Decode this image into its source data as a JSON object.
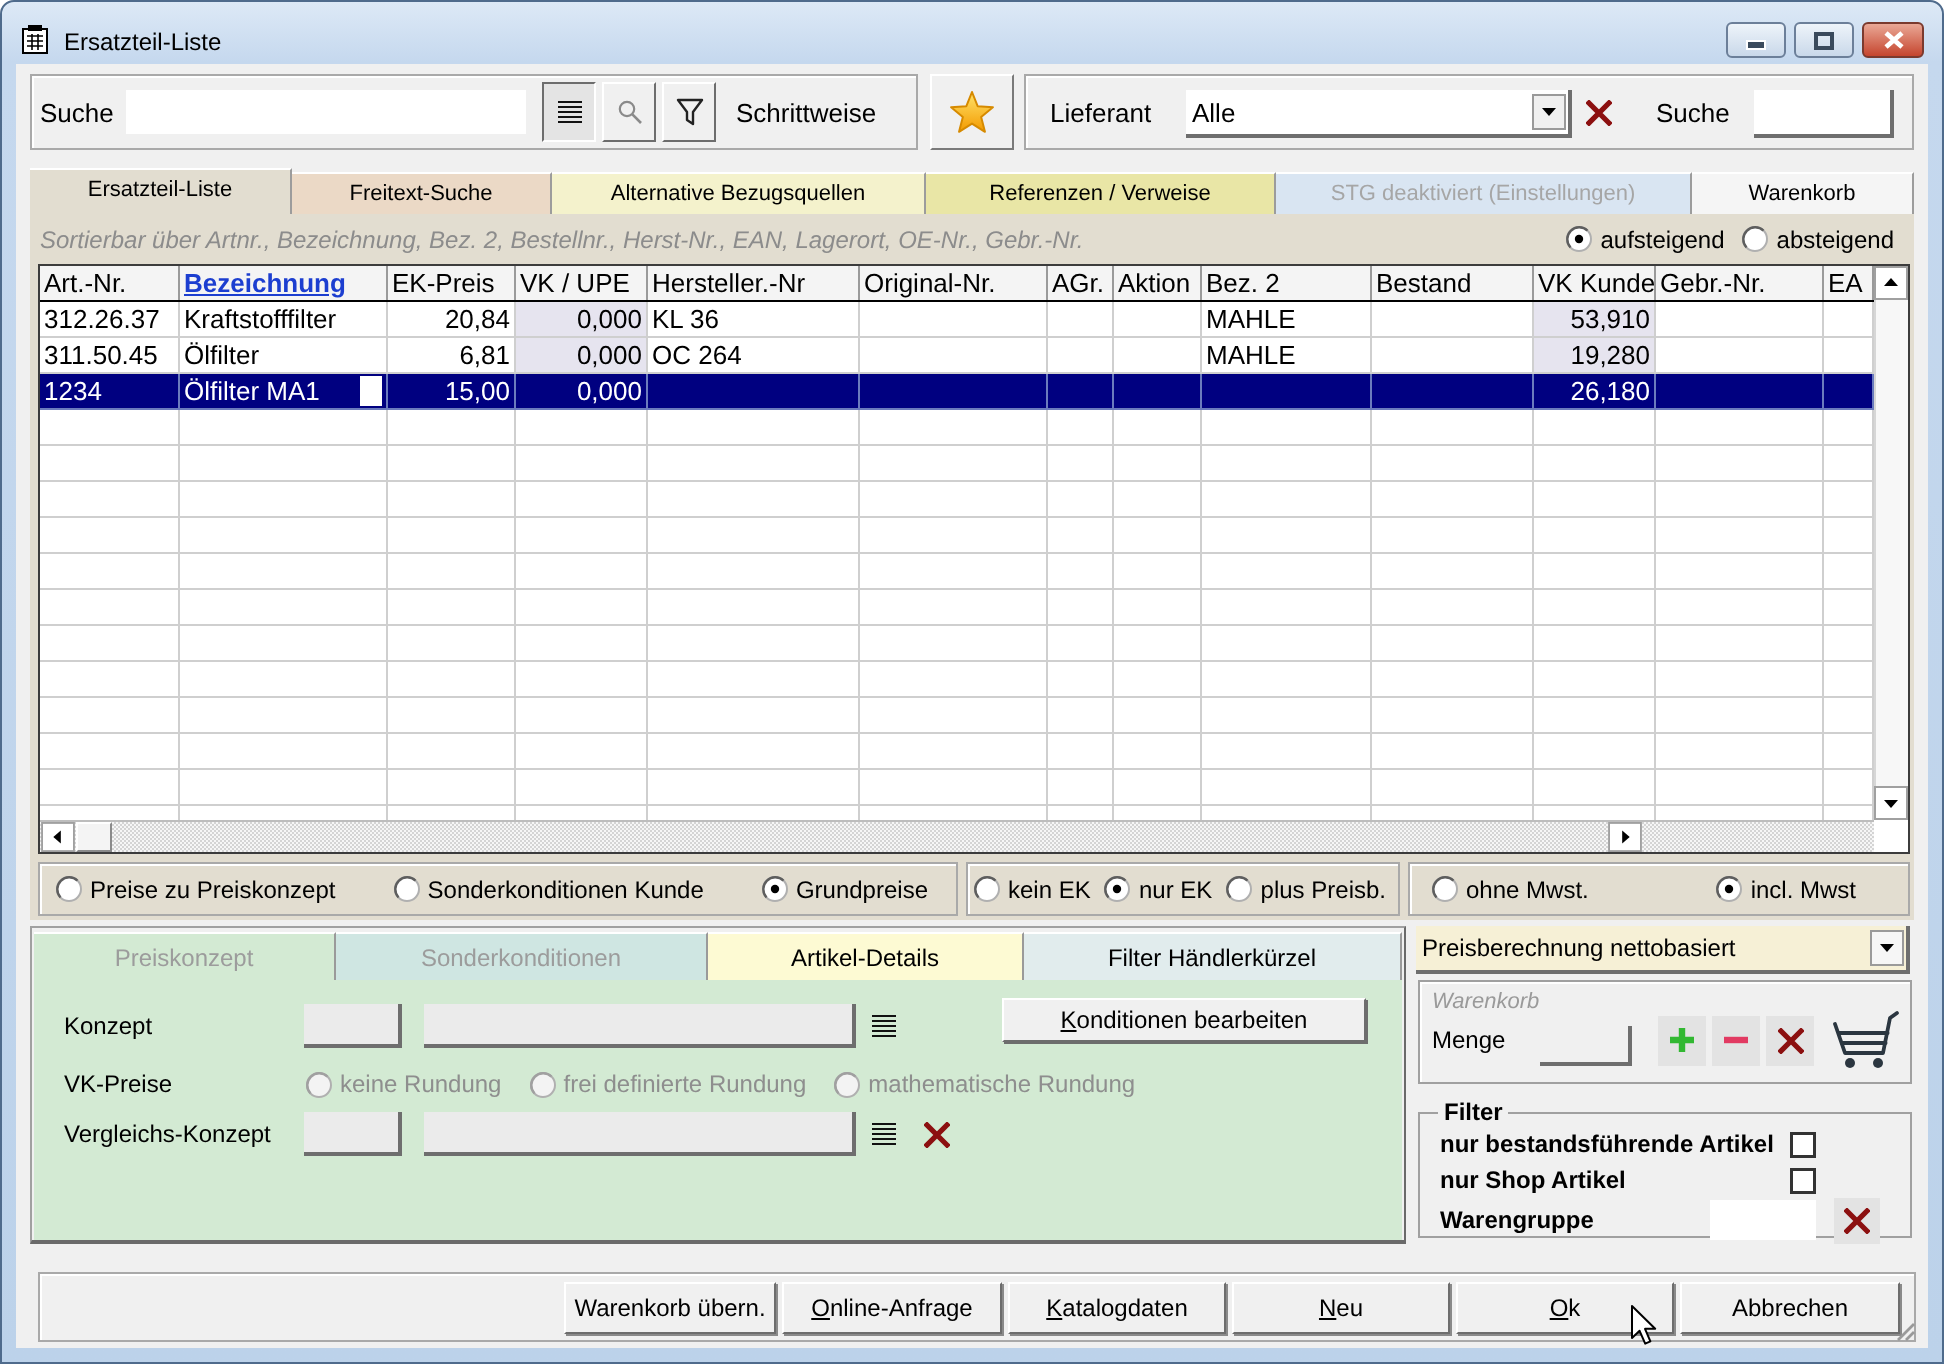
{
  "window": {
    "title": "Ersatzteil-Liste"
  },
  "search": {
    "label": "Suche",
    "view_buttons": [
      {
        "kind": "list",
        "selected": true
      },
      {
        "kind": "search",
        "selected": false
      },
      {
        "kind": "filter",
        "selected": false
      }
    ],
    "mode": "Schrittweise"
  },
  "supplier": {
    "label": "Lieferant",
    "value": "Alle",
    "search_label": "Suche"
  },
  "tabs": [
    {
      "label": "Ersatzteil-Liste",
      "selected": true,
      "disabled": false,
      "color": "#e2ddd0"
    },
    {
      "label": "Freitext-Suche",
      "selected": false,
      "disabled": false,
      "color": "#ebd9c6"
    },
    {
      "label": "Alternative Bezugsquellen",
      "selected": false,
      "disabled": false,
      "color": "#f4f2cc"
    },
    {
      "label": "Referenzen / Verweise",
      "selected": false,
      "disabled": false,
      "color": "#e9e6a6"
    },
    {
      "label": "STG deaktiviert (Einstellungen)",
      "selected": false,
      "disabled": true,
      "color": "#d9e5f2"
    },
    {
      "label": "Warenkorb",
      "selected": false,
      "disabled": false,
      "color": "#f5f5f5"
    }
  ],
  "sort": {
    "hint": "Sortierbar über Artnr., Bezeichnung, Bez. 2, Bestellnr., Herst-Nr., EAN, Lagerort, OE-Nr., Gebr.-Nr.",
    "order": [
      {
        "label": "aufsteigend",
        "selected": true
      },
      {
        "label": "absteigend",
        "selected": false
      }
    ]
  },
  "table": {
    "columns": [
      {
        "label": "Art.-Nr.",
        "kind": "text",
        "sorted": false
      },
      {
        "label": "Bezeichnung",
        "kind": "text",
        "sorted": true
      },
      {
        "label": "EK-Preis",
        "kind": "number",
        "sorted": false
      },
      {
        "label": "VK / UPE",
        "kind": "calculated",
        "sorted": false
      },
      {
        "label": "Hersteller.-Nr",
        "kind": "text",
        "sorted": false
      },
      {
        "label": "Original-Nr.",
        "kind": "text",
        "sorted": false
      },
      {
        "label": "AGr.",
        "kind": "text",
        "sorted": false
      },
      {
        "label": "Aktion",
        "kind": "text",
        "sorted": false
      },
      {
        "label": "Bez. 2",
        "kind": "text",
        "sorted": false
      },
      {
        "label": "Bestand",
        "kind": "text",
        "sorted": false
      },
      {
        "label": "VK Kunde",
        "kind": "calculated",
        "sorted": false
      },
      {
        "label": "Gebr.-Nr.",
        "kind": "text",
        "sorted": false
      },
      {
        "label": "EA",
        "kind": "text",
        "sorted": false
      }
    ],
    "rows": [
      {
        "cells": [
          "312.26.37",
          "Kraftstofffilter",
          "20,84",
          "0,000",
          "KL 36",
          null,
          null,
          null,
          "MAHLE",
          null,
          "53,910",
          null,
          null
        ],
        "selected": false
      },
      {
        "cells": [
          "311.50.45",
          "Ölfilter",
          "6,81",
          "0,000",
          "OC 264",
          null,
          null,
          null,
          "MAHLE",
          null,
          "19,280",
          null,
          null
        ],
        "selected": false
      },
      {
        "cells": [
          "1234",
          "Ölfilter MA1",
          "15,00",
          "0,000",
          null,
          null,
          null,
          null,
          null,
          null,
          "26,180",
          null,
          null
        ],
        "selected": true
      }
    ]
  },
  "price_basis": [
    {
      "label": "Preise zu Preiskonzept",
      "selected": false
    },
    {
      "label": "Sonderkonditionen Kunde",
      "selected": false
    },
    {
      "label": "Grundpreise",
      "selected": true
    }
  ],
  "purchase_price": [
    {
      "label": "kein EK",
      "selected": false
    },
    {
      "label": "nur EK",
      "selected": true
    },
    {
      "label": "plus Preisb.",
      "selected": false
    }
  ],
  "vat": [
    {
      "label": "ohne Mwst.",
      "selected": false
    },
    {
      "label": "incl. Mwst",
      "selected": true
    }
  ],
  "detail_tabs": [
    {
      "label": "Preiskonzept",
      "selected": true,
      "disabled": true,
      "color": "#d3ead3"
    },
    {
      "label": "Sonderkonditionen",
      "selected": false,
      "disabled": true,
      "color": "#cfe6e2"
    },
    {
      "label": "Artikel-Details",
      "selected": false,
      "disabled": false,
      "color": "#fdfad3"
    },
    {
      "label": "Filter Händlerkürzel",
      "selected": false,
      "disabled": false,
      "color": "#e1eced"
    }
  ],
  "detail_panel": {
    "concept_label": "Konzept",
    "edit_button": {
      "label": "Konditionen bearbeiten",
      "mnemonic": true
    },
    "rounding_label": "VK-Preise",
    "rounding": [
      {
        "label": "keine Rundung",
        "selected": false,
        "disabled": true
      },
      {
        "label": "frei definierte Rundung",
        "selected": false,
        "disabled": true
      },
      {
        "label": "mathematische Rundung",
        "selected": false,
        "disabled": true
      }
    ],
    "compare_label": "Vergleichs-Konzept"
  },
  "price_mode": {
    "value": "Preisberechnung nettobasiert"
  },
  "cart": {
    "title": "Warenkorb",
    "quantity_label": "Menge"
  },
  "filter": {
    "title": "Filter",
    "options": [
      {
        "label": "nur bestandsführende Artikel",
        "checked": false
      },
      {
        "label": "nur Shop Artikel",
        "checked": false
      }
    ],
    "group_label": "Warengruppe"
  },
  "buttons": [
    {
      "label": "Warenkorb übern.",
      "mnemonic": false
    },
    {
      "label": "Online-Anfrage",
      "mnemonic": true
    },
    {
      "label": "Katalogdaten",
      "mnemonic": true
    },
    {
      "label": "Neu",
      "mnemonic": true
    },
    {
      "label": "Ok",
      "mnemonic": true
    },
    {
      "label": "Abbrechen",
      "mnemonic": false
    }
  ]
}
